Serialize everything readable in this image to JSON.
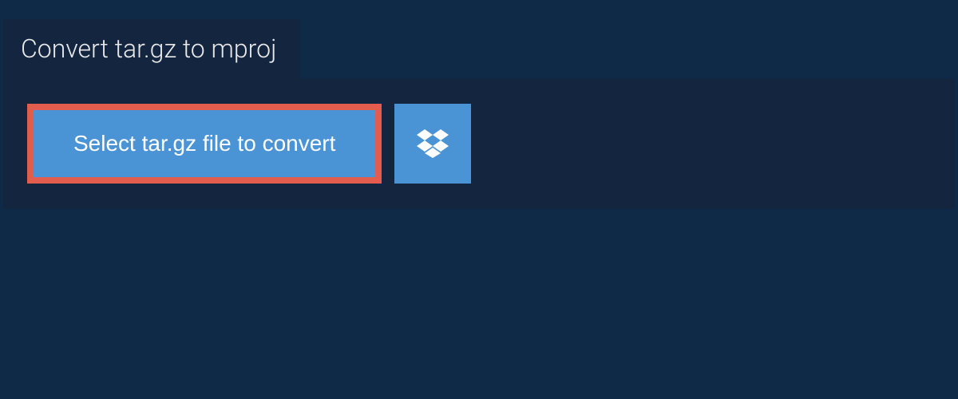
{
  "header": {
    "title": "Convert tar.gz to mproj"
  },
  "actions": {
    "select_file_label": "Select tar.gz file to convert"
  },
  "colors": {
    "background": "#0e2a47",
    "panel": "#13253f",
    "button": "#4a94d6",
    "highlight_border": "#e35d4e",
    "text_light": "#e8e8e8",
    "text_white": "#ffffff"
  }
}
